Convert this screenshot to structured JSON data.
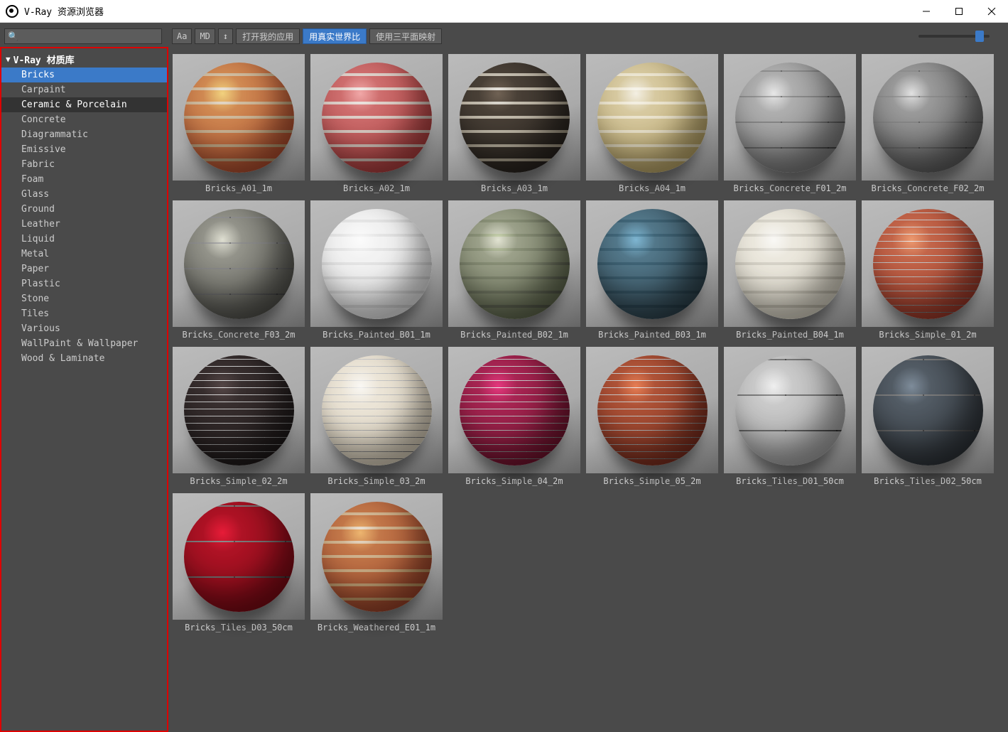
{
  "window": {
    "title": "V-Ray 资源浏览器"
  },
  "toolbar": {
    "aa": "Aa",
    "md": "MD",
    "arrow": "↕",
    "open_apps": "打开我的应用",
    "real_world": "用真实世界比",
    "triplanar": "使用三平面映射"
  },
  "tree": {
    "root": "V-Ray 材质库",
    "items": [
      {
        "label": "Bricks",
        "state": "selected"
      },
      {
        "label": "Carpaint",
        "state": ""
      },
      {
        "label": "Ceramic & Porcelain",
        "state": "hover"
      },
      {
        "label": "Concrete",
        "state": ""
      },
      {
        "label": "Diagrammatic",
        "state": ""
      },
      {
        "label": "Emissive",
        "state": ""
      },
      {
        "label": "Fabric",
        "state": ""
      },
      {
        "label": "Foam",
        "state": ""
      },
      {
        "label": "Glass",
        "state": ""
      },
      {
        "label": "Ground",
        "state": ""
      },
      {
        "label": "Leather",
        "state": ""
      },
      {
        "label": "Liquid",
        "state": ""
      },
      {
        "label": "Metal",
        "state": ""
      },
      {
        "label": "Paper",
        "state": ""
      },
      {
        "label": "Plastic",
        "state": ""
      },
      {
        "label": "Stone",
        "state": ""
      },
      {
        "label": "Tiles",
        "state": ""
      },
      {
        "label": "Various",
        "state": ""
      },
      {
        "label": "WallPaint & Wallpaper",
        "state": ""
      },
      {
        "label": "Wood & Laminate",
        "state": ""
      }
    ]
  },
  "materials": [
    {
      "label": "Bricks_A01_1m",
      "c1": "#c87848",
      "c2": "#c8b090",
      "type": "brick"
    },
    {
      "label": "Bricks_A02_1m",
      "c1": "#c66060",
      "c2": "#d8c8c0",
      "type": "brick"
    },
    {
      "label": "Bricks_A03_1m",
      "c1": "#403830",
      "c2": "#b8b0a0",
      "type": "brick"
    },
    {
      "label": "Bricks_A04_1m",
      "c1": "#d0c090",
      "c2": "#e8e0c8",
      "type": "brick"
    },
    {
      "label": "Bricks_Concrete_F01_2m",
      "c1": "#a0a0a0",
      "c2": "#909090",
      "type": "block"
    },
    {
      "label": "Bricks_Concrete_F02_2m",
      "c1": "#888888",
      "c2": "#787878",
      "type": "block"
    },
    {
      "label": "Bricks_Concrete_F03_2m",
      "c1": "#808078",
      "c2": "#707068",
      "type": "block"
    },
    {
      "label": "Bricks_Painted_B01_1m",
      "c1": "#f0f0f0",
      "c2": "#e0e0e0",
      "type": "brick"
    },
    {
      "label": "Bricks_Painted_B02_1m",
      "c1": "#8a9078",
      "c2": "#787e68",
      "type": "brick"
    },
    {
      "label": "Bricks_Painted_B03_1m",
      "c1": "#486878",
      "c2": "#385868",
      "type": "brick"
    },
    {
      "label": "Bricks_Painted_B04_1m",
      "c1": "#e8e4d8",
      "c2": "#d0ccc0",
      "type": "brick"
    },
    {
      "label": "Bricks_Simple_01_2m",
      "c1": "#b85840",
      "c2": "#a84830",
      "type": "fine"
    },
    {
      "label": "Bricks_Simple_02_2m",
      "c1": "#302828",
      "c2": "#201818",
      "type": "fine"
    },
    {
      "label": "Bricks_Simple_03_2m",
      "c1": "#e8e0d0",
      "c2": "#d8d0c0",
      "type": "fine"
    },
    {
      "label": "Bricks_Simple_04_2m",
      "c1": "#982048",
      "c2": "#881838",
      "type": "fine"
    },
    {
      "label": "Bricks_Simple_05_2m",
      "c1": "#a04830",
      "c2": "#903820",
      "type": "fine"
    },
    {
      "label": "Bricks_Tiles_D01_50cm",
      "c1": "#c0c0c0",
      "c2": "#a0a0a0",
      "type": "tile"
    },
    {
      "label": "Bricks_Tiles_D02_50cm",
      "c1": "#485058",
      "c2": "#384048",
      "type": "tile"
    },
    {
      "label": "Bricks_Tiles_D03_50cm",
      "c1": "#a01020",
      "c2": "#900818",
      "type": "tile"
    },
    {
      "label": "Bricks_Weathered_E01_1m",
      "c1": "#b86840",
      "c2": "#c8a880",
      "type": "brick"
    }
  ]
}
